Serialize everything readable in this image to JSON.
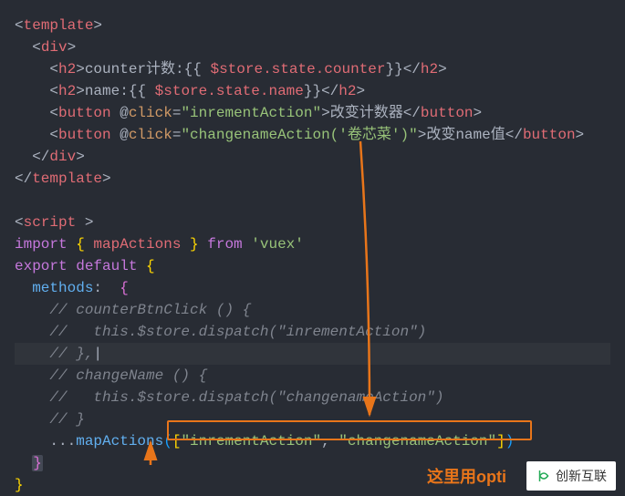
{
  "code": {
    "l1_bracket1": "<",
    "l1_tag": "template",
    "l1_bracket2": ">",
    "l2_indent": "  ",
    "l2_bracket1": "<",
    "l2_tag": "div",
    "l2_bracket2": ">",
    "l3_indent": "    ",
    "l3_bracket1": "<",
    "l3_tag": "h2",
    "l3_bracket2": ">",
    "l3_text1": "counter计数:",
    "l3_brace1": "{{",
    "l3_expr": " $store.state.counter",
    "l3_brace2": "}}",
    "l3_bracket3": "</",
    "l3_tag2": "h2",
    "l3_bracket4": ">",
    "l4_indent": "    ",
    "l4_bracket1": "<",
    "l4_tag": "h2",
    "l4_bracket2": ">",
    "l4_text1": "name:",
    "l4_brace1": "{{",
    "l4_expr": " $store.state.name",
    "l4_brace2": "}}",
    "l4_bracket3": "</",
    "l4_tag2": "h2",
    "l4_bracket4": ">",
    "l5_indent": "    ",
    "l5_bracket1": "<",
    "l5_tag": "button",
    "l5_at": " @",
    "l5_attr": "click",
    "l5_eq": "=",
    "l5_string": "\"inrementAction\"",
    "l5_bracket2": ">",
    "l5_text": "改变计数器",
    "l5_bracket3": "</",
    "l5_tag2": "button",
    "l5_bracket4": ">",
    "l6_indent": "    ",
    "l6_bracket1": "<",
    "l6_tag": "button",
    "l6_at": " @",
    "l6_attr": "click",
    "l6_eq": "=",
    "l6_string": "\"changenameAction('卷芯菜')\"",
    "l6_bracket2": ">",
    "l6_text": "改变name值",
    "l6_bracket3": "</",
    "l6_tag2": "button",
    "l6_bracket4": ">",
    "l7_indent": "  ",
    "l7_bracket1": "</",
    "l7_tag": "div",
    "l7_bracket2": ">",
    "l8_bracket1": "</",
    "l8_tag": "template",
    "l8_bracket2": ">",
    "l10_bracket1": "<",
    "l10_tag": "script ",
    "l10_bracket2": ">",
    "l11_keyword1": "import",
    "l11_brace1": " { ",
    "l11_name": "mapActions",
    "l11_brace2": " } ",
    "l11_keyword2": "from",
    "l11_string": " 'vuex'",
    "l12_keyword1": "export",
    "l12_keyword2": " default",
    "l12_brace": " {",
    "l13_indent": "  ",
    "l13_name": "methods",
    "l13_colon": ":  ",
    "l13_brace": "{",
    "l14_indent": "    ",
    "l14_comment": "// counterBtnClick () {",
    "l15_indent": "    ",
    "l15_comment": "//   this.$store.dispatch(\"inrementAction\")",
    "l16_indent": "    ",
    "l16_comment": "// },",
    "l16_cursor": "|",
    "l17_indent": "    ",
    "l17_comment": "// changeName () {",
    "l18_indent": "    ",
    "l18_comment": "//   this.$store.dispatch(\"changenameAction\")",
    "l19_indent": "    ",
    "l19_comment": "// }",
    "l20_indent": "    ",
    "l20_spread": "...",
    "l20_func": "mapActions",
    "l20_paren1": "(",
    "l20_bracket1": "[",
    "l20_string1": "\"inrementAction\"",
    "l20_comma": ", ",
    "l20_string2": "\"changenameAction\"",
    "l20_bracket2": "]",
    "l20_paren2": ")",
    "l21_indent": "  ",
    "l21_brace": "}",
    "l22_brace": "}"
  },
  "footer": "这里用opti",
  "watermark": "创新互联"
}
